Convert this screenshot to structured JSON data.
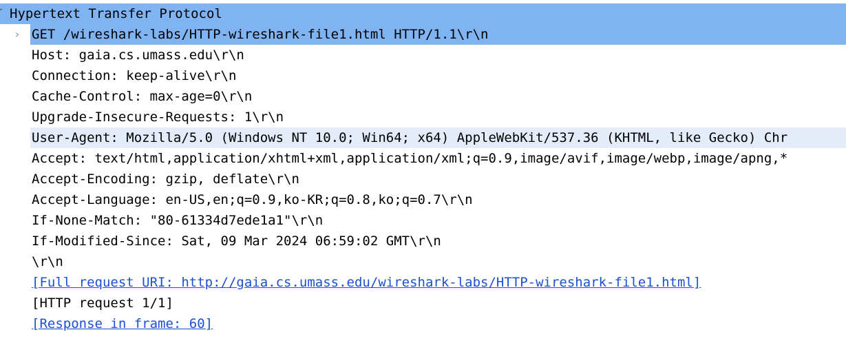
{
  "panel": {
    "section_title": "Hypertext Transfer Protocol",
    "collapse_glyph": "ˇ",
    "expand_glyph": "›",
    "fields": [
      "GET /wireshark-labs/HTTP-wireshark-file1.html HTTP/1.1\\r\\n",
      "Host: gaia.cs.umass.edu\\r\\n",
      "Connection: keep-alive\\r\\n",
      "Cache-Control: max-age=0\\r\\n",
      "Upgrade-Insecure-Requests: 1\\r\\n",
      "User-Agent: Mozilla/5.0 (Windows NT 10.0; Win64; x64) AppleWebKit/537.36 (KHTML, like Gecko) Chr",
      "Accept: text/html,application/xhtml+xml,application/xml;q=0.9,image/avif,image/webp,image/apng,*",
      "Accept-Encoding: gzip, deflate\\r\\n",
      "Accept-Language: en-US,en;q=0.9,ko-KR;q=0.8,ko;q=0.7\\r\\n",
      "If-None-Match: \"80-61334d7ede1a1\"\\r\\n",
      "If-Modified-Since: Sat, 09 Mar 2024 06:59:02 GMT\\r\\n",
      "\\r\\n",
      "[Full request URI: http://gaia.cs.umass.edu/wireshark-labs/HTTP-wireshark-file1.html]",
      "[HTTP request 1/1]",
      "[Response in frame: 60]"
    ]
  },
  "colors": {
    "selection": "#7fb3f2",
    "hover": "#e3ecf8",
    "link": "#1a4fd6"
  }
}
